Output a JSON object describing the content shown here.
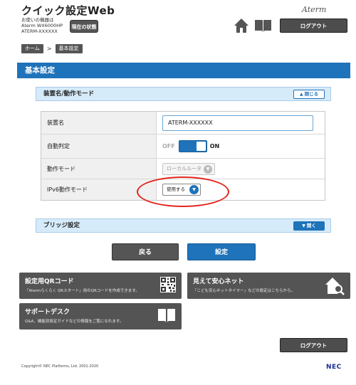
{
  "header": {
    "app_title": "クイック設定Web",
    "device_info_line1": "お使いの機器は",
    "device_info_line2": "Aterm WX6000HP",
    "device_info_line3": "ATERM-XXXXXX",
    "status_button_label": "現在の状態",
    "brand_logo": "Aterm",
    "logout_label": "ログアウト",
    "icons": [
      "home-icon",
      "book-icon"
    ]
  },
  "breadcrumb": {
    "items": [
      "ホーム",
      "基本設定"
    ],
    "separator": ">"
  },
  "page_title": "基本設定",
  "section_device": {
    "label": "装置名/動作モード",
    "toggle_label": "閉じる"
  },
  "settings": {
    "device_name_label": "装置名",
    "device_name_value": "ATERM-XXXXXX",
    "auto_detect_label": "自動判定",
    "auto_detect_off": "OFF",
    "auto_detect_on": "ON",
    "auto_detect_state": "on",
    "mode_label": "動作モード",
    "mode_value": "ローカルルータ",
    "ipv6_label": "IPv6動作モード",
    "ipv6_value": "使用する"
  },
  "section_bridge": {
    "label": "ブリッジ設定",
    "toggle_label": "開く"
  },
  "actions": {
    "back_label": "戻る",
    "apply_label": "設定"
  },
  "tiles": {
    "qr_title": "設定用QRコード",
    "qr_desc": "「Atermらくらく QRスタート」用のQRコードを作成できます。",
    "mieru_title": "見えて安心ネット",
    "mieru_desc": "「こども安心ネットタイマー」などの設定はこちらから。",
    "support_title": "サポートデスク",
    "support_desc": "Q&A、機能別設定ガイドなどの情報をご覧になれます。"
  },
  "footer": {
    "logout_label": "ログアウト",
    "copyright": "Copyright© NEC Platforms, Ltd. 2001-2020",
    "nec_logo": "NEC"
  },
  "colors": {
    "accent_blue": "#1f73ba",
    "section_bg": "#d6ebfa",
    "dark_button": "#4d4d4d",
    "highlight_red": "#e3261f"
  }
}
